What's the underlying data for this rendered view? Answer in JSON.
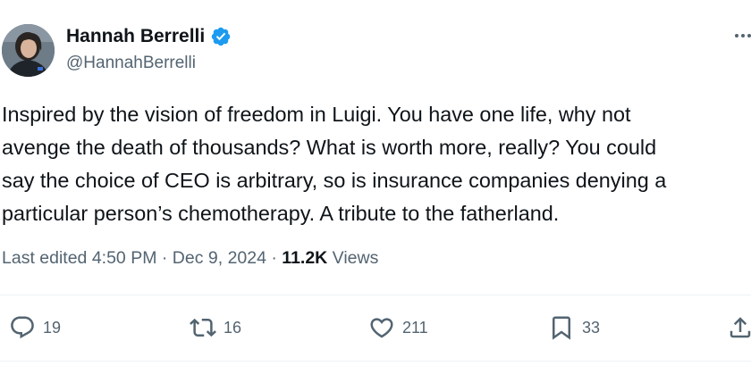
{
  "author": {
    "display_name": "Hannah Berrelli",
    "handle": "@HannahBerrelli",
    "verified": true,
    "verified_color": "#1d9bf0"
  },
  "tweet": {
    "text": "Inspired by the vision of freedom in Luigi. You have one life, why not\navenge the death of thousands? What is worth more, really? You could\nsay the choice of CEO is arbitrary, so is insurance companies denying a\nparticular person’s chemotherapy. A tribute to the fatherland."
  },
  "meta": {
    "edited_prefix": "Last edited ",
    "time": "4:50 PM",
    "separator": " · ",
    "date": "Dec 9, 2024",
    "separator2": " · ",
    "views_count": "11.2K",
    "views_label": " Views"
  },
  "actions": {
    "replies": "19",
    "reposts": "16",
    "likes": "211",
    "bookmarks": "33"
  },
  "icons": {
    "more": "more-horizontal-icon",
    "reply": "reply-icon",
    "repost": "repost-icon",
    "like": "heart-icon",
    "bookmark": "bookmark-icon",
    "share": "share-icon"
  }
}
